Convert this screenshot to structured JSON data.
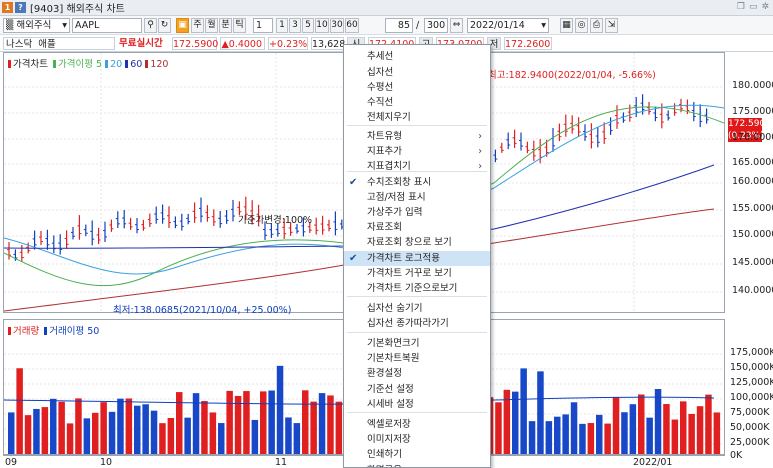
{
  "window": {
    "code": "[9403]",
    "title": "해외주식 차트",
    "badge1": "1",
    "badge2": "?"
  },
  "toolbar": {
    "market": "해외주식",
    "ticker": "AAPL",
    "btn_j": "주",
    "btn_w": "월",
    "btn_b": "분",
    "btn_t": "틱",
    "period_value": "1",
    "periods": [
      "1",
      "3",
      "5",
      "10",
      "30",
      "60"
    ],
    "count_value": "85",
    "count_total": "300",
    "date": "2022/01/14"
  },
  "quote": {
    "exchange": "나스닥",
    "name": "애플",
    "realtime": "무료실시간",
    "price": "172.5900",
    "change": "▲0.4000",
    "change_pct": "+0.23%",
    "volume": "13,628",
    "open_label": "시",
    "open": "172.4100",
    "high_label": "고",
    "high": "173.0700",
    "low_label": "저",
    "low": "172.2600"
  },
  "price_legend": {
    "price": "가격차트",
    "ma_label": "가격이평",
    "ma1": "5",
    "ma2": "20",
    "ma3": "60",
    "ma4": "120"
  },
  "volume_legend": {
    "vol": "거래량",
    "vma": "거래이평 50"
  },
  "annotations": {
    "high": "최고:182.9400(2022/01/04, -5.66%)",
    "low": "최저:138.0685(2021/10/04, +25.00%)",
    "base": "기준가변경:100%"
  },
  "last_price": {
    "value": "172.5900",
    "pct": "(0.23%)"
  },
  "price_axis": [
    "180.0000",
    "175.0000",
    "170.0000",
    "165.0000",
    "160.0000",
    "155.0000",
    "150.0000",
    "145.0000",
    "140.0000"
  ],
  "volume_axis": [
    "175,000K",
    "150,000K",
    "125,000K",
    "100,000K",
    "75,000K",
    "50,000K",
    "25,000K",
    "0K"
  ],
  "x_axis": [
    "09",
    "10",
    "11",
    "2022/01"
  ],
  "menu": {
    "items": [
      {
        "label": "추세선",
        "arrow": "",
        "checked": false
      },
      {
        "label": "십자선",
        "arrow": "",
        "checked": false
      },
      {
        "label": "수평선",
        "arrow": "",
        "checked": false
      },
      {
        "label": "수직선",
        "arrow": "",
        "checked": false
      },
      {
        "label": "전체지우기",
        "arrow": "",
        "checked": false
      },
      {
        "label": "차트유형",
        "arrow": "›",
        "checked": false
      },
      {
        "label": "지표추가",
        "arrow": "›",
        "checked": false
      },
      {
        "label": "지표겹치기",
        "arrow": "›",
        "checked": false
      },
      {
        "label": "수치조회창 표시",
        "arrow": "",
        "checked": true
      },
      {
        "label": "고점/저점 표시",
        "arrow": "",
        "checked": false
      },
      {
        "label": "가상주가 입력",
        "arrow": "",
        "checked": false
      },
      {
        "label": "자료조회",
        "arrow": "",
        "checked": false
      },
      {
        "label": "자료조회 창으로 보기",
        "arrow": "",
        "checked": false
      },
      {
        "label": "가격차트 로그적용",
        "arrow": "",
        "checked": true,
        "selected": true
      },
      {
        "label": "가격차트 거꾸로 보기",
        "arrow": "",
        "checked": false
      },
      {
        "label": "가격차트 기준으로보기",
        "arrow": "",
        "checked": false
      },
      {
        "label": "십자선 숨기기",
        "arrow": "",
        "checked": false
      },
      {
        "label": "십자선 종가따라가기",
        "arrow": "",
        "checked": false
      },
      {
        "label": "기본화면크기",
        "arrow": "",
        "checked": false
      },
      {
        "label": "기본차트복원",
        "arrow": "",
        "checked": false
      },
      {
        "label": "환경설정",
        "arrow": "",
        "checked": false
      },
      {
        "label": "기준선 설정",
        "arrow": "",
        "checked": false
      },
      {
        "label": "시세바 설정",
        "arrow": "",
        "checked": false
      },
      {
        "label": "엑셀로저장",
        "arrow": "",
        "checked": false
      },
      {
        "label": "이미지저장",
        "arrow": "",
        "checked": false
      },
      {
        "label": "인쇄하기",
        "arrow": "",
        "checked": false
      },
      {
        "label": "화면공유",
        "arrow": "",
        "checked": false
      }
    ]
  },
  "colors": {
    "up": "#e02020",
    "down": "#1040c0",
    "ma5": "#4caf50",
    "ma20": "#3aa0e0",
    "ma60": "#2030b0",
    "ma120": "#b03030",
    "menu_sel": "#cfe3f7"
  }
}
